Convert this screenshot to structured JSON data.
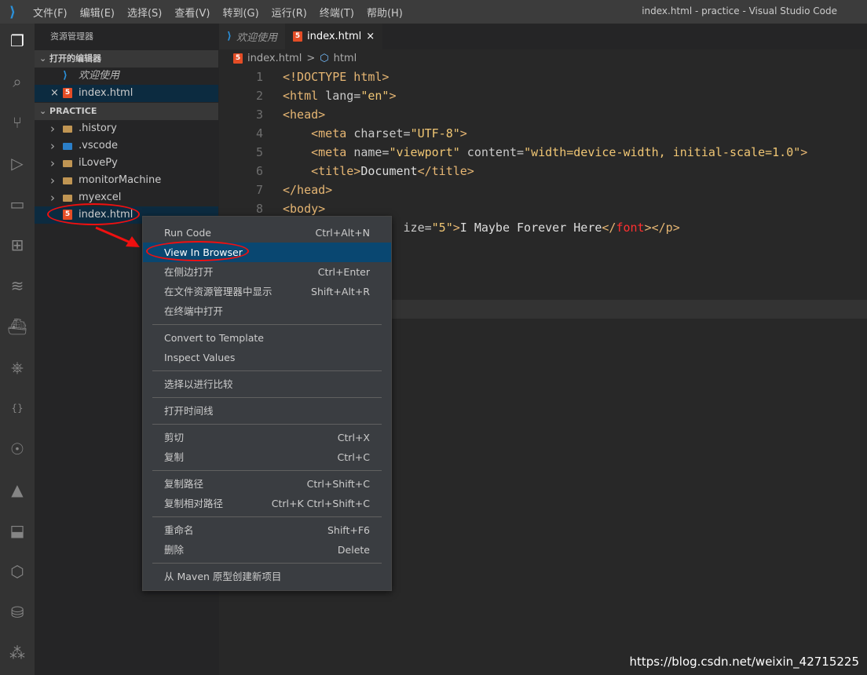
{
  "titlebar": {
    "menus": [
      "文件(F)",
      "编辑(E)",
      "选择(S)",
      "查看(V)",
      "转到(G)",
      "运行(R)",
      "终端(T)",
      "帮助(H)"
    ],
    "window_title": "index.html - practice - Visual Studio Code"
  },
  "activity_icons": [
    "explorer-icon",
    "search-icon",
    "source-control-icon",
    "run-debug-icon",
    "remote-explorer-icon",
    "extensions-icon",
    "layers-icon",
    "docker-icon",
    "kubernetes-icon",
    "json-icon",
    "jupyter-icon",
    "azure-icon",
    "deploy-icon",
    "package-icon",
    "database-icon",
    "graph-icon"
  ],
  "sidebar": {
    "title": "资源管理器",
    "open_editors": {
      "label": "打开的编辑器",
      "items": [
        {
          "name": "欢迎使用"
        },
        {
          "name": "index.html"
        }
      ]
    },
    "project": {
      "label": "PRACTICE",
      "items": [
        {
          "name": ".history",
          "type": "folder"
        },
        {
          "name": ".vscode",
          "type": "vscode-folder"
        },
        {
          "name": "iLovePy",
          "type": "folder"
        },
        {
          "name": "monitorMachine",
          "type": "folder"
        },
        {
          "name": "myexcel",
          "type": "folder"
        },
        {
          "name": "index.html",
          "type": "html"
        }
      ]
    }
  },
  "tabs": [
    {
      "label": "欢迎使用"
    },
    {
      "label": "index.html",
      "close": "×"
    }
  ],
  "breadcrumb": {
    "file": "index.html",
    "symbol": "html",
    "sep": ">"
  },
  "code_lines": [
    {
      "n": "1",
      "tokens": [
        [
          "t",
          "<!DOCTYPE html>"
        ]
      ]
    },
    {
      "n": "2",
      "tokens": [
        [
          "t",
          "<html "
        ],
        [
          "a",
          "lang="
        ],
        [
          "s",
          "\"en\""
        ],
        [
          "t",
          ">"
        ]
      ]
    },
    {
      "n": "3",
      "tokens": [
        [
          "t",
          "<head>"
        ]
      ]
    },
    {
      "n": "4",
      "tokens": [
        [
          "p",
          "    "
        ],
        [
          "t",
          "<meta "
        ],
        [
          "a",
          "charset="
        ],
        [
          "s",
          "\"UTF-8\""
        ],
        [
          "t",
          ">"
        ]
      ]
    },
    {
      "n": "5",
      "tokens": [
        [
          "p",
          "    "
        ],
        [
          "t",
          "<meta "
        ],
        [
          "a",
          "name="
        ],
        [
          "s",
          "\"viewport\""
        ],
        [
          "a",
          " content="
        ],
        [
          "s",
          "\"width=device-width, initial-scale=1.0\""
        ],
        [
          "t",
          ">"
        ]
      ]
    },
    {
      "n": "6",
      "tokens": [
        [
          "p",
          "    "
        ],
        [
          "t",
          "<title>"
        ],
        [
          "p",
          "Document"
        ],
        [
          "t",
          "</title>"
        ]
      ]
    },
    {
      "n": "7",
      "tokens": [
        [
          "t",
          "</head>"
        ]
      ]
    },
    {
      "n": "8",
      "tokens": [
        [
          "t",
          "<body>"
        ]
      ]
    },
    {
      "n": "",
      "tokens": [
        [
          "p",
          "                 "
        ],
        [
          "a",
          "ize="
        ],
        [
          "s",
          "\"5\""
        ],
        [
          "t",
          ">"
        ],
        [
          "p",
          "I Maybe Forever Here"
        ],
        [
          "t",
          "</"
        ],
        [
          "r",
          "font"
        ],
        [
          "t",
          "></p>"
        ]
      ]
    }
  ],
  "context_menu": [
    {
      "label": "Run Code",
      "shortcut": "Ctrl+Alt+N"
    },
    {
      "label": "View In Browser",
      "shortcut": "",
      "highlighted": true
    },
    {
      "label": "在侧边打开",
      "shortcut": "Ctrl+Enter"
    },
    {
      "label": "在文件资源管理器中显示",
      "shortcut": "Shift+Alt+R"
    },
    {
      "label": "在终端中打开",
      "shortcut": ""
    },
    {
      "sep": true
    },
    {
      "label": "Convert to Template",
      "shortcut": ""
    },
    {
      "label": "Inspect Values",
      "shortcut": ""
    },
    {
      "sep": true
    },
    {
      "label": "选择以进行比较",
      "shortcut": ""
    },
    {
      "sep": true
    },
    {
      "label": "打开时间线",
      "shortcut": ""
    },
    {
      "sep": true
    },
    {
      "label": "剪切",
      "shortcut": "Ctrl+X"
    },
    {
      "label": "复制",
      "shortcut": "Ctrl+C"
    },
    {
      "sep": true
    },
    {
      "label": "复制路径",
      "shortcut": "Ctrl+Shift+C"
    },
    {
      "label": "复制相对路径",
      "shortcut": "Ctrl+K Ctrl+Shift+C"
    },
    {
      "sep": true
    },
    {
      "label": "重命名",
      "shortcut": "Shift+F6"
    },
    {
      "label": "删除",
      "shortcut": "Delete"
    },
    {
      "sep": true
    },
    {
      "label": "从 Maven 原型创建新项目",
      "shortcut": ""
    }
  ],
  "watermark": "https://blog.csdn.net/weixin_42715225",
  "colors": {
    "accent": "#094771",
    "annotation": "#f01010"
  }
}
